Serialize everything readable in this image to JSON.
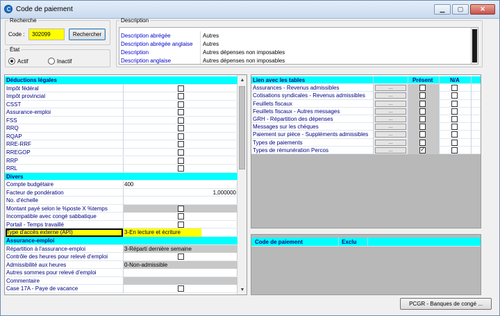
{
  "window": {
    "title": "Code de paiement"
  },
  "recherche": {
    "legend": "Recherche",
    "code_label": "Code :",
    "code_value": "302099",
    "button": "Rechercher"
  },
  "etat": {
    "legend": "État",
    "actif": "Actif",
    "inactif": "Inactif",
    "selected": "Actif"
  },
  "description": {
    "legend": "Description",
    "rows": [
      {
        "key": "Description abrégée",
        "value": "Autres"
      },
      {
        "key": "Description abrégée anglaise",
        "value": "Autres"
      },
      {
        "key": "Description",
        "value": "Autres dépenses non imposables"
      },
      {
        "key": "Description anglaise",
        "value": "Autres dépenses non imposables"
      }
    ]
  },
  "left_grid": {
    "rows": [
      {
        "label": "Déductions légales",
        "type": "header"
      },
      {
        "label": "Impôt fédéral",
        "type": "check",
        "checked": false
      },
      {
        "label": "Impôt provincial",
        "type": "check",
        "checked": false
      },
      {
        "label": "CSST",
        "type": "check",
        "checked": false
      },
      {
        "label": "Assurance-emploi",
        "type": "check",
        "checked": false
      },
      {
        "label": "FSS",
        "type": "check",
        "checked": false
      },
      {
        "label": "RRQ",
        "type": "check",
        "checked": false
      },
      {
        "label": "RQAP",
        "type": "check",
        "checked": false
      },
      {
        "label": "RRE-RRF",
        "type": "check",
        "checked": false
      },
      {
        "label": "RREGOP",
        "type": "check",
        "checked": false
      },
      {
        "label": "RRP",
        "type": "check",
        "checked": false
      },
      {
        "label": "RRL",
        "type": "check",
        "checked": false
      },
      {
        "label": "Divers",
        "type": "header"
      },
      {
        "label": "Compte budgétaire",
        "type": "text",
        "value": "400"
      },
      {
        "label": "Facteur de pondération",
        "type": "num",
        "value": "1,000000"
      },
      {
        "label": "No. d'échelle",
        "type": "text",
        "value": ""
      },
      {
        "label": "Montant payé selon le %poste X %temps",
        "type": "graycheck",
        "checked": false
      },
      {
        "label": "Incompatible avec congé sabbatique",
        "type": "check",
        "checked": false
      },
      {
        "label": "Portail - Temps travaillé",
        "type": "check",
        "checked": false
      },
      {
        "label": "Type d'accès externe (API)",
        "type": "selected",
        "value": "3-En lecture et écriture"
      },
      {
        "label": "Assurance-emploi",
        "type": "header"
      },
      {
        "label": "Répartition à l'assurance-emploi",
        "type": "graytext",
        "value": "3-Réparti dernière semaine"
      },
      {
        "label": "Contrôle des heures pour relevé d'emploi",
        "type": "check",
        "checked": false
      },
      {
        "label": "Admissibilité aux heures",
        "type": "graytext",
        "value": "0-Non-admissible"
      },
      {
        "label": "Autres sommes pour relevé d'emploi",
        "type": "text",
        "value": ""
      },
      {
        "label": "Commentaire",
        "type": "graytext",
        "value": ""
      },
      {
        "label": "Case 17A - Paye de vacance",
        "type": "check",
        "checked": false
      }
    ]
  },
  "right_grid": {
    "headers": {
      "liens": "Lien avec les tables",
      "present": "Présent",
      "na": "N/A"
    },
    "dots": "...",
    "rows": [
      {
        "label": "Assurances - Revenus admissibles",
        "present": false,
        "na": false
      },
      {
        "label": "Cotisations syndicales - Revenus admissibles",
        "present": false,
        "na": false
      },
      {
        "label": "Feuillets fiscaux",
        "present": false,
        "na": false
      },
      {
        "label": "Feuillets fiscaux - Autres messages",
        "present": false,
        "na": false
      },
      {
        "label": "GRH - Répartition des dépenses",
        "present": false,
        "na": false
      },
      {
        "label": "Messages sur les chèques",
        "present": false,
        "na": false
      },
      {
        "label": "Paiement sur pièce - Suppléments admissibles",
        "present": false,
        "na": false
      },
      {
        "label": "Types de paiements",
        "present": false,
        "na": false
      },
      {
        "label": "Types de rémunération Percos",
        "present": true,
        "na": false
      }
    ]
  },
  "code_grid": {
    "col1": "Code de paiement",
    "col2": "Exclu"
  },
  "footer": {
    "pcgr_button": "PCGR - Banques de congé ..."
  }
}
